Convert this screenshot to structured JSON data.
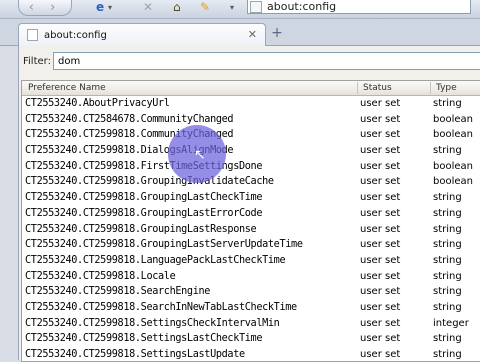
{
  "browser": {
    "url": "about:config",
    "tab_title": "about:config",
    "back_forward": "‹ ›",
    "close_icon": "x-icon",
    "accent": "#3b5a8a"
  },
  "filter": {
    "label": "Filter:",
    "value": "dom"
  },
  "table": {
    "headers": [
      "Preference Name",
      "Status",
      "Type"
    ],
    "rows": [
      {
        "name": "CT2553240.AboutPrivacyUrl",
        "status": "user set",
        "type": "string"
      },
      {
        "name": "CT2553240.CT2584678.CommunityChanged",
        "status": "user set",
        "type": "boolean"
      },
      {
        "name": "CT2553240.CT2599818.CommunityChanged",
        "status": "user set",
        "type": "boolean"
      },
      {
        "name": "CT2553240.CT2599818.DialogsAlignMode",
        "status": "user set",
        "type": "string"
      },
      {
        "name": "CT2553240.CT2599818.FirstTimeSettingsDone",
        "status": "user set",
        "type": "boolean"
      },
      {
        "name": "CT2553240.CT2599818.GroupingInvalidateCache",
        "status": "user set",
        "type": "boolean"
      },
      {
        "name": "CT2553240.CT2599818.GroupingLastCheckTime",
        "status": "user set",
        "type": "string"
      },
      {
        "name": "CT2553240.CT2599818.GroupingLastErrorCode",
        "status": "user set",
        "type": "string"
      },
      {
        "name": "CT2553240.CT2599818.GroupingLastResponse",
        "status": "user set",
        "type": "string"
      },
      {
        "name": "CT2553240.CT2599818.GroupingLastServerUpdateTime",
        "status": "user set",
        "type": "string"
      },
      {
        "name": "CT2553240.CT2599818.LanguagePackLastCheckTime",
        "status": "user set",
        "type": "string"
      },
      {
        "name": "CT2553240.CT2599818.Locale",
        "status": "user set",
        "type": "string"
      },
      {
        "name": "CT2553240.CT2599818.SearchEngine",
        "status": "user set",
        "type": "string"
      },
      {
        "name": "CT2553240.CT2599818.SearchInNewTabLastCheckTime",
        "status": "user set",
        "type": "string"
      },
      {
        "name": "CT2553240.CT2599818.SettingsCheckIntervalMin",
        "status": "user set",
        "type": "integer"
      },
      {
        "name": "CT2553240.CT2599818.SettingsLastCheckTime",
        "status": "user set",
        "type": "string"
      },
      {
        "name": "CT2553240.CT2599818.SettingsLastUpdate",
        "status": "user set",
        "type": "string"
      }
    ]
  }
}
